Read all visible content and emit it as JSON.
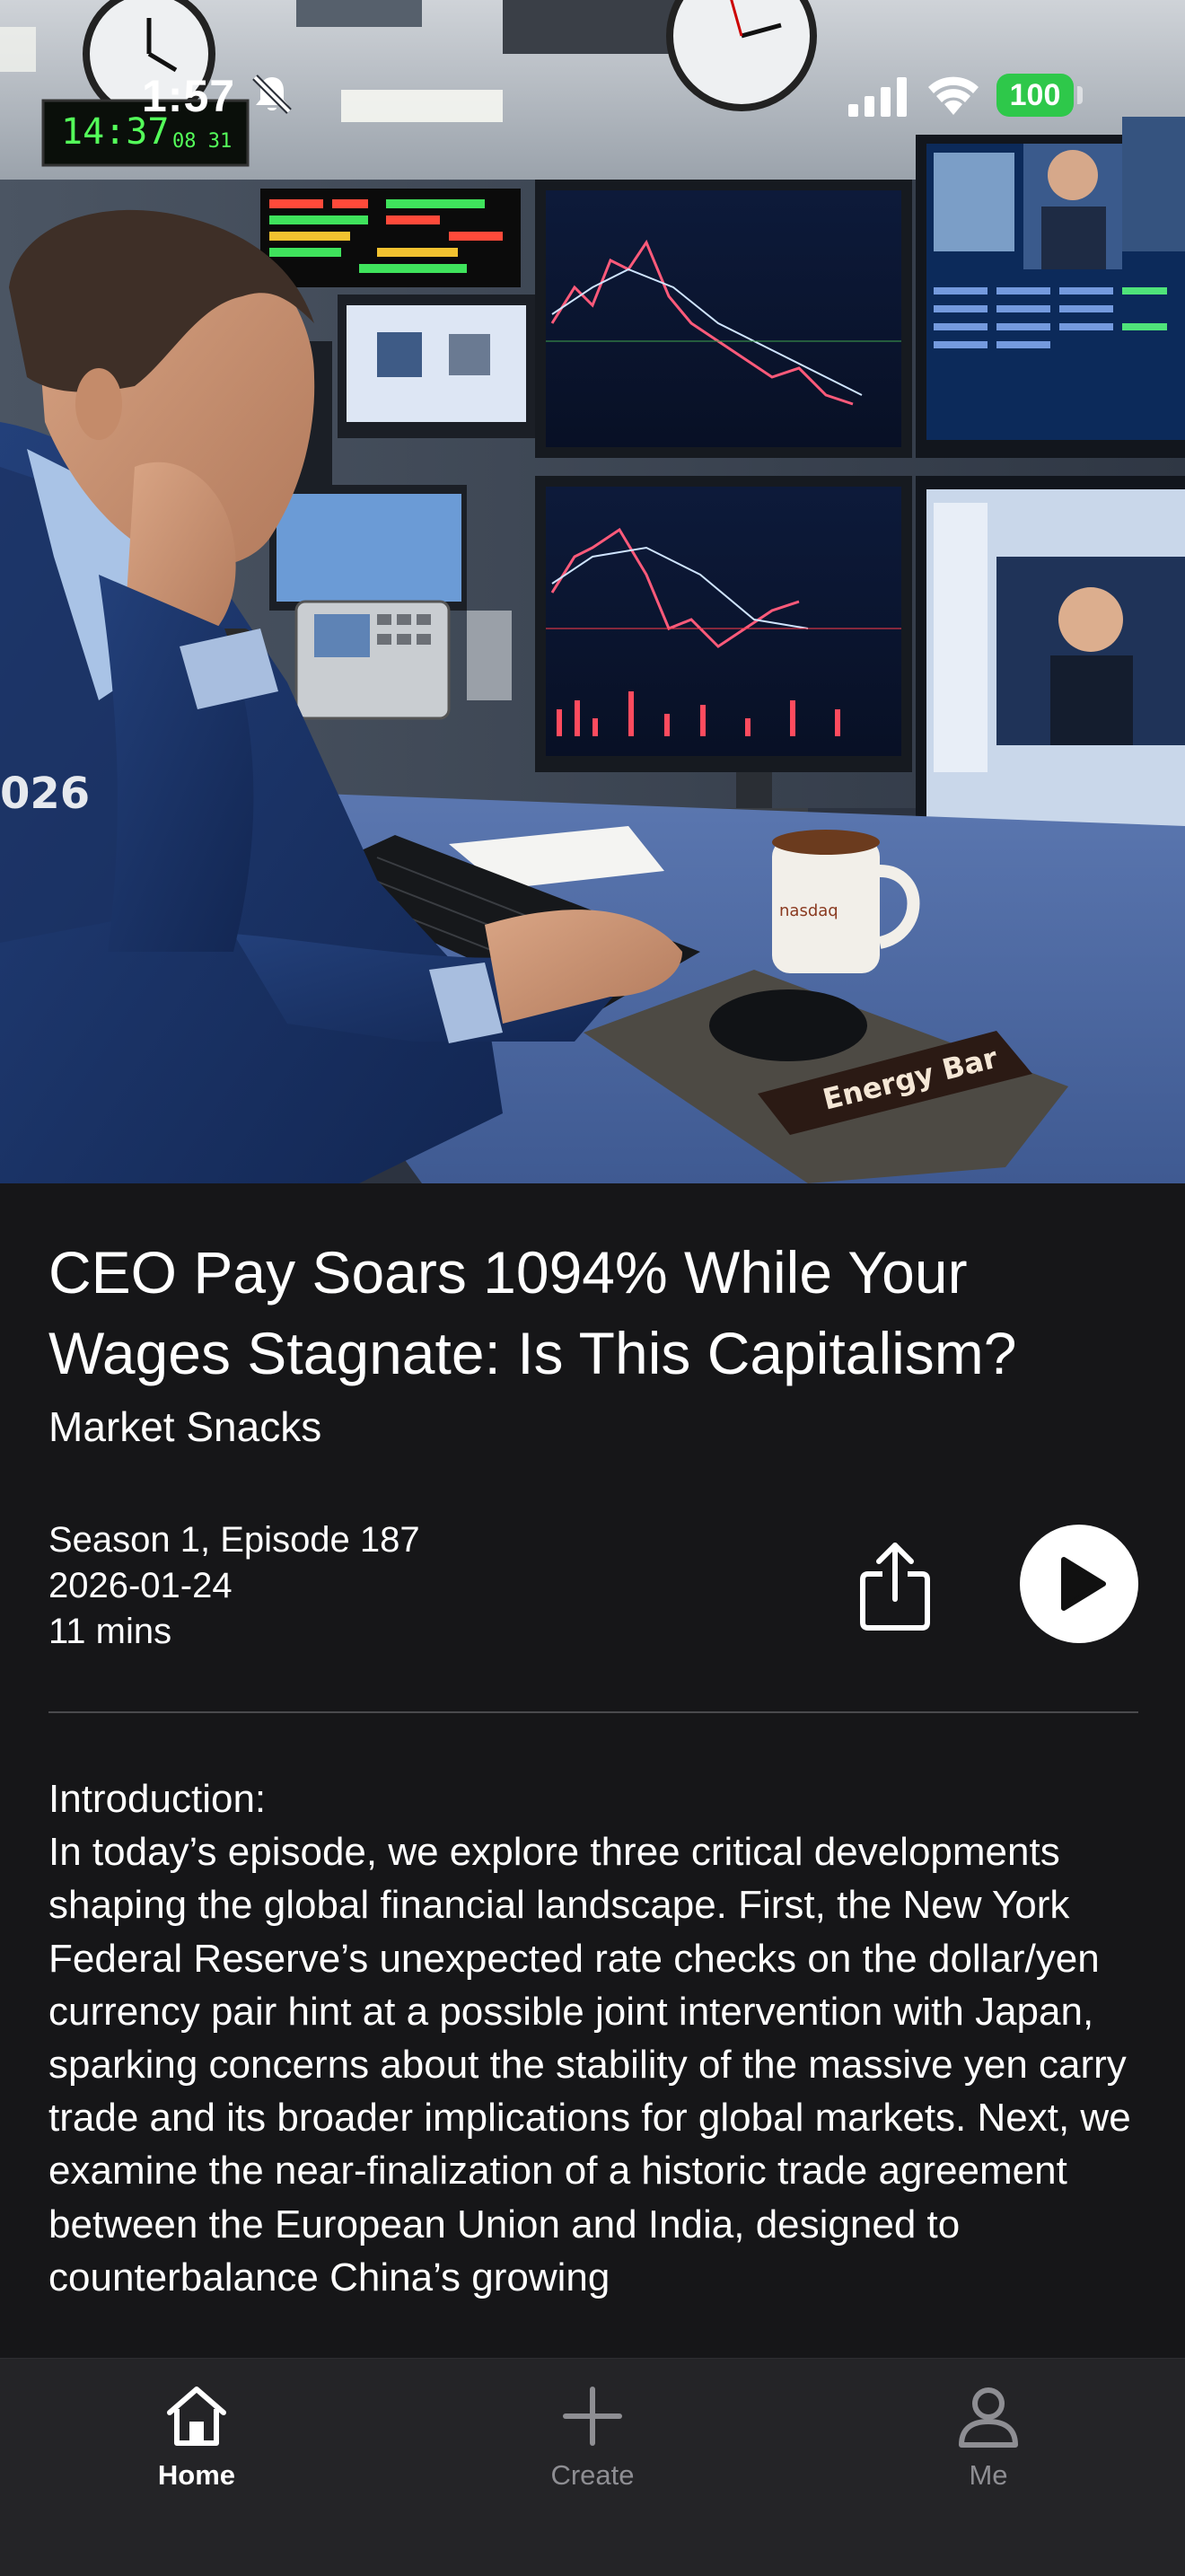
{
  "status_bar": {
    "time": "1:57",
    "battery": "100"
  },
  "hero": {
    "wall_clock": "14:37",
    "wall_clock_secondary": "08 31",
    "jacket_number": "026",
    "energy_bar_label": "Energy Bar"
  },
  "episode": {
    "title": "CEO Pay Soars 1094% While Your Wages Stagnate: Is This Capitalism?",
    "podcast": "Market Snacks",
    "season_episode": "Season 1, Episode 187",
    "date": "2026-01-24",
    "duration": "11 mins",
    "description_heading": "Introduction:",
    "description_body": "In today’s episode, we explore three critical developments shaping the global financial landscape. First, the New York Federal Reserve’s unexpected rate checks on the dollar/yen currency pair hint at a possible joint intervention with Japan, sparking concerns about the stability of the massive yen carry trade and its broader implications for global markets. Next, we examine the near-finalization of a historic trade agreement between the European Union and India, designed to counterbalance China’s growing"
  },
  "tab_bar": {
    "home": "Home",
    "create": "Create",
    "me": "Me"
  },
  "colors": {
    "background": "#161618",
    "tab_bar": "#242427",
    "battery": "#2ec84a",
    "inactive_tab": "#8e8e93"
  },
  "icons": [
    "bell-slash-icon",
    "signal-icon",
    "wifi-icon",
    "share-icon",
    "play-icon",
    "home-icon",
    "plus-icon",
    "person-icon"
  ]
}
